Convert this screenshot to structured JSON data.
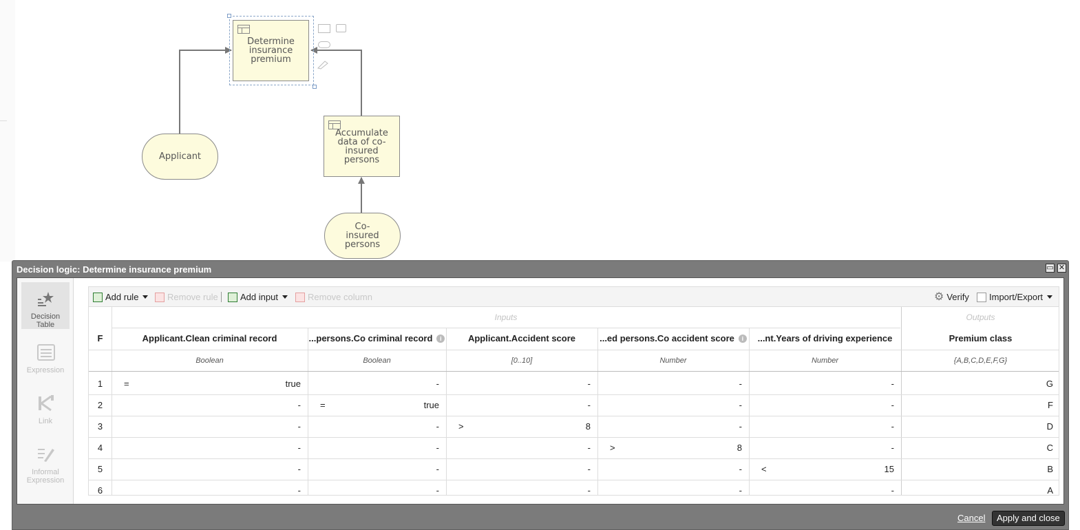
{
  "canvas": {
    "nodes": {
      "determine": "Determine insurance premium",
      "accumulate": "Accumulate data of co-insured persons",
      "applicant": "Applicant",
      "coinsured": "Co-insured persons"
    },
    "palette_icons": [
      "rectangle-shape-icon",
      "annotation-shape-icon",
      "rounded-shape-icon",
      "pencil-icon"
    ]
  },
  "dialog": {
    "title": "Decision logic: Determine insurance premium",
    "sidebar": [
      {
        "label": "Decision Table",
        "icon": "decision-table-icon",
        "active": true
      },
      {
        "label": "Expression",
        "icon": "expression-icon",
        "active": false
      },
      {
        "label": "Link",
        "icon": "link-icon",
        "active": false
      },
      {
        "label": "Informal Expression",
        "icon": "informal-expression-icon",
        "active": false
      }
    ],
    "toolbar": {
      "add_rule": "Add rule",
      "remove_rule": "Remove rule",
      "add_input": "Add input",
      "remove_column": "Remove column",
      "verify": "Verify",
      "import_export": "Import/Export"
    },
    "table": {
      "group_inputs": "Inputs",
      "group_outputs": "Outputs",
      "hit_policy": "F",
      "columns": [
        {
          "header": "Applicant.Clean criminal record",
          "type": "Boolean",
          "info": false
        },
        {
          "header": "...persons.Co criminal record",
          "type": "Boolean",
          "info": true
        },
        {
          "header": "Applicant.Accident score",
          "type": "[0..10]",
          "info": false
        },
        {
          "header": "...ed persons.Co accident score",
          "type": "Number",
          "info": true
        },
        {
          "header": "...nt.Years of driving experience",
          "type": "Number",
          "info": false
        },
        {
          "header": "Premium class",
          "type": "{A,B,C,D,E,F,G}",
          "info": false
        }
      ],
      "rows": [
        {
          "num": "1",
          "cells": [
            {
              "op": "=",
              "v": "true"
            },
            {
              "op": "",
              "v": "-"
            },
            {
              "op": "",
              "v": "-"
            },
            {
              "op": "",
              "v": "-"
            },
            {
              "op": "",
              "v": "-"
            },
            {
              "op": "",
              "v": "G"
            }
          ]
        },
        {
          "num": "2",
          "cells": [
            {
              "op": "",
              "v": "-"
            },
            {
              "op": "=",
              "v": "true"
            },
            {
              "op": "",
              "v": "-"
            },
            {
              "op": "",
              "v": "-"
            },
            {
              "op": "",
              "v": "-"
            },
            {
              "op": "",
              "v": "F"
            }
          ]
        },
        {
          "num": "3",
          "cells": [
            {
              "op": "",
              "v": "-"
            },
            {
              "op": "",
              "v": "-"
            },
            {
              "op": ">",
              "v": "8"
            },
            {
              "op": "",
              "v": "-"
            },
            {
              "op": "",
              "v": "-"
            },
            {
              "op": "",
              "v": "D"
            }
          ]
        },
        {
          "num": "4",
          "cells": [
            {
              "op": "",
              "v": "-"
            },
            {
              "op": "",
              "v": "-"
            },
            {
              "op": "",
              "v": "-"
            },
            {
              "op": ">",
              "v": "8"
            },
            {
              "op": "",
              "v": "-"
            },
            {
              "op": "",
              "v": "C"
            }
          ]
        },
        {
          "num": "5",
          "cells": [
            {
              "op": "",
              "v": "-"
            },
            {
              "op": "",
              "v": "-"
            },
            {
              "op": "",
              "v": "-"
            },
            {
              "op": "",
              "v": "-"
            },
            {
              "op": "<",
              "v": "15"
            },
            {
              "op": "",
              "v": "B"
            }
          ]
        },
        {
          "num": "6",
          "cells": [
            {
              "op": "",
              "v": "-"
            },
            {
              "op": "",
              "v": "-"
            },
            {
              "op": "",
              "v": "-"
            },
            {
              "op": "",
              "v": "-"
            },
            {
              "op": "",
              "v": "-"
            },
            {
              "op": "",
              "v": "A"
            }
          ]
        }
      ]
    },
    "footer": {
      "cancel": "Cancel",
      "apply": "Apply and close"
    }
  }
}
